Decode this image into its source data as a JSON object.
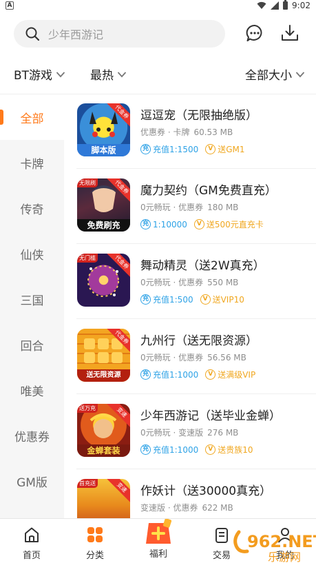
{
  "status_bar": {
    "time": "9:02",
    "left_badge": "A"
  },
  "search": {
    "placeholder": "少年西游记"
  },
  "filters": [
    {
      "label": "BT游戏"
    },
    {
      "label": "最热"
    },
    {
      "label": "全部大小"
    }
  ],
  "categories": [
    {
      "label": "全部",
      "active": true
    },
    {
      "label": "卡牌"
    },
    {
      "label": "传奇"
    },
    {
      "label": "仙侠"
    },
    {
      "label": "三国"
    },
    {
      "label": "回合"
    },
    {
      "label": "唯美"
    },
    {
      "label": "优惠券"
    },
    {
      "label": "GM版"
    }
  ],
  "games": [
    {
      "title": "逗逗宠（无限抽绝版）",
      "meta": "优惠券 · 卡牌",
      "size": "60.53 MB",
      "tag1": "充值1:1500",
      "tag2": "送GM1",
      "corner": "代金券",
      "caption": "脚本版"
    },
    {
      "title": "魔力契约（GM免费直充）",
      "meta": "0元畅玩 · 优惠券",
      "size": "180 MB",
      "tag1": "1:10000",
      "tag2": "送500元直充卡",
      "corner": "代金券",
      "left_badge": "无限刷",
      "caption": "免费刷充"
    },
    {
      "title": "舞动精灵（送2W真充）",
      "meta": "0元畅玩 · 优惠券",
      "size": "550 MB",
      "tag1": "充值1:500",
      "tag2": "送VIP10",
      "corner": "代金券",
      "left_badge": "无门槛"
    },
    {
      "title": "九州行（送无限资源）",
      "meta": "0元畅玩 · 优惠券",
      "size": "56.56 MB",
      "tag1": "充值1:1000",
      "tag2": "送满级VIP",
      "corner": "代金券",
      "caption": "送无限资源"
    },
    {
      "title": "少年西游记（送毕业金蝉）",
      "meta": "0元畅玩 · 变速版",
      "size": "276 MB",
      "tag1": "充值1:1000",
      "tag2": "送贵族10",
      "corner": "变速",
      "left_badge": "送万充",
      "caption": "金蝉套装"
    },
    {
      "title": "作妖计（送30000真充）",
      "meta": "变速版 · 优惠券",
      "size": "622 MB",
      "tag1": "",
      "tag2": "",
      "corner": "变速",
      "left_badge": "首充送"
    }
  ],
  "tag_icons": {
    "blue": "充",
    "gold": "V"
  },
  "bottom_nav": [
    {
      "label": "首页",
      "icon": "home-icon"
    },
    {
      "label": "分类",
      "icon": "category-icon"
    },
    {
      "label": "福利",
      "icon": "gift-icon"
    },
    {
      "label": "交易",
      "icon": "trade-icon"
    },
    {
      "label": "我的",
      "icon": "profile-icon"
    }
  ],
  "watermark": {
    "text": "962.NET",
    "sub": "乐游网"
  },
  "colors": {
    "accent": "#ff7a1a",
    "blue_tag": "#2ea2e6",
    "gold_tag": "#f0a71f"
  }
}
